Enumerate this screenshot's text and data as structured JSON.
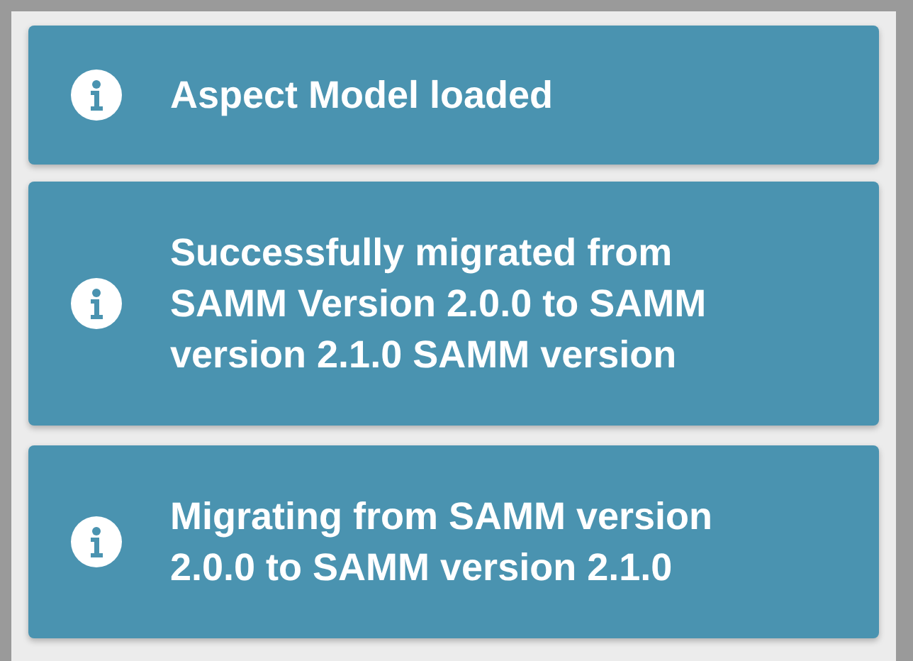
{
  "notifications": [
    {
      "kind": "info",
      "message": "Aspect Model loaded"
    },
    {
      "kind": "info",
      "message": "Successfully migrated from SAMM Version 2.0.0 to SAMM version 2.1.0 SAMM version"
    },
    {
      "kind": "info",
      "message": "Migrating from SAMM version 2.0.0 to SAMM version 2.1.0"
    }
  ]
}
